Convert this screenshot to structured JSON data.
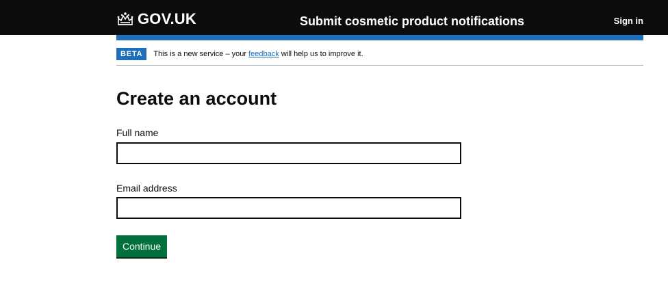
{
  "header": {
    "logo_text": "GOV.UK",
    "service_name": "Submit cosmetic product notifications",
    "sign_in": "Sign in"
  },
  "phase_banner": {
    "tag": "BETA",
    "text_before": "This is a new service – your ",
    "link": "feedback",
    "text_after": " will help us to improve it."
  },
  "page": {
    "title": "Create an account",
    "fields": [
      {
        "label": "Full name",
        "value": "",
        "placeholder": ""
      },
      {
        "label": "Email address",
        "value": "",
        "placeholder": ""
      }
    ],
    "continue_label": "Continue"
  },
  "colors": {
    "header_bg": "#0b0c0c",
    "accent_blue": "#1d70b8",
    "button_green": "#00703c",
    "border": "#b1b4b6"
  },
  "icons": {
    "logo": "crown-icon"
  }
}
